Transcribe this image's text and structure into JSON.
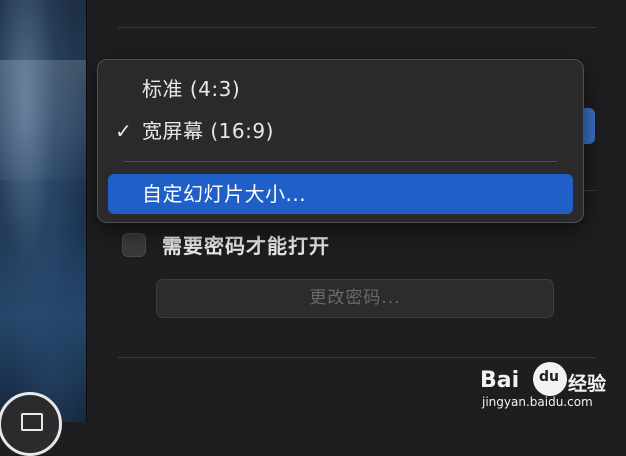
{
  "menu": {
    "items": [
      {
        "label": "标准 (4:3)",
        "checked": false,
        "highlighted": false
      },
      {
        "label": "宽屏幕 (16:9)",
        "checked": true,
        "highlighted": false
      },
      {
        "label": "自定幻灯片大小...",
        "checked": false,
        "highlighted": true
      }
    ],
    "check_glyph": "✓"
  },
  "password": {
    "checkbox_label": "需要密码才能打开",
    "checked": false,
    "change_button_label": "更改密码..."
  },
  "watermark": {
    "brand_part1": "Bai",
    "brand_part2": "经验",
    "url": "jingyan.baidu.com"
  },
  "icons": [
    "check-icon",
    "baidu-paw-icon",
    "dock-app-icon"
  ],
  "colors": {
    "highlight": "#1f5fc7",
    "menu_bg": "#2a2a2d",
    "panel_bg": "#1e1e20"
  }
}
